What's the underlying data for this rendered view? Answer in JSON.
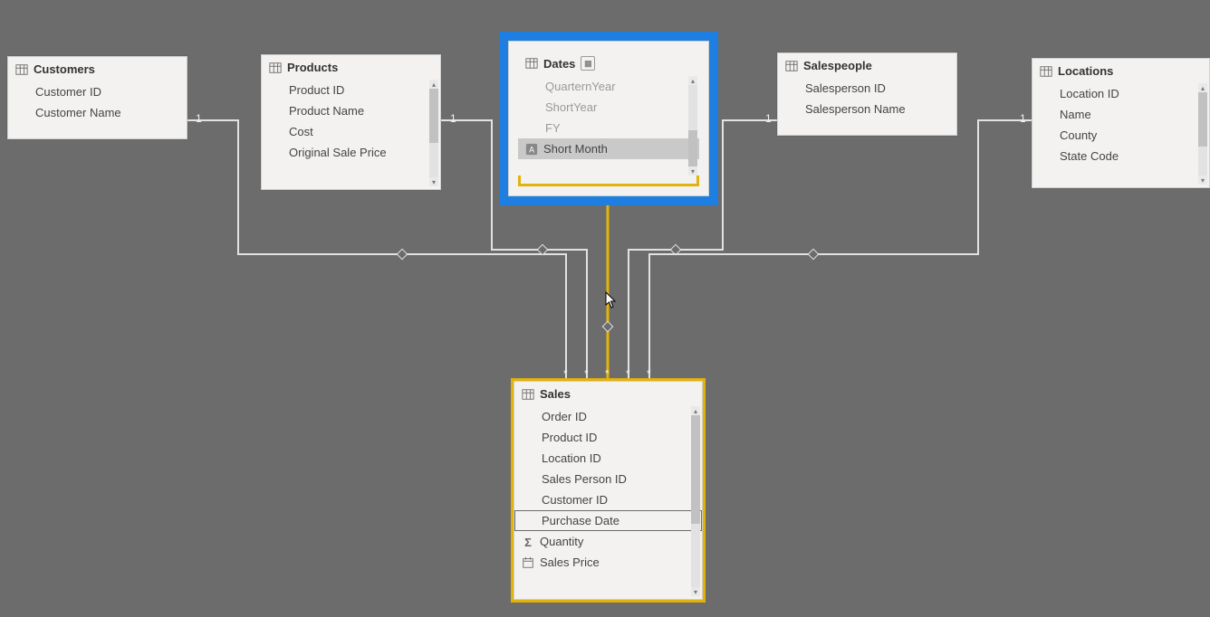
{
  "tables": {
    "customers": {
      "title": "Customers",
      "fields": {
        "f0": "Customer ID",
        "f1": "Customer Name"
      }
    },
    "products": {
      "title": "Products",
      "fields": {
        "f0": "Product ID",
        "f1": "Product Name",
        "f2": "Cost",
        "f3": "Original Sale Price"
      }
    },
    "dates": {
      "title": "Dates",
      "fields": {
        "f0": "QuarternYear",
        "f1": "ShortYear",
        "f2": "FY",
        "f3": "Short Month"
      }
    },
    "salespeople": {
      "title": "Salespeople",
      "fields": {
        "f0": "Salesperson ID",
        "f1": "Salesperson Name"
      }
    },
    "locations": {
      "title": "Locations",
      "fields": {
        "f0": "Location ID",
        "f1": "Name",
        "f2": "County",
        "f3": "State Code"
      }
    },
    "sales": {
      "title": "Sales",
      "fields": {
        "f0": "Order ID",
        "f1": "Product ID",
        "f2": "Location ID",
        "f3": "Sales Person ID",
        "f4": "Customer ID",
        "f5": "Purchase Date",
        "f6": "Quantity",
        "f7": "Sales Price"
      }
    }
  },
  "cardinality": {
    "one": "1",
    "many": "*"
  },
  "icons": {
    "sigma": "Σ"
  }
}
